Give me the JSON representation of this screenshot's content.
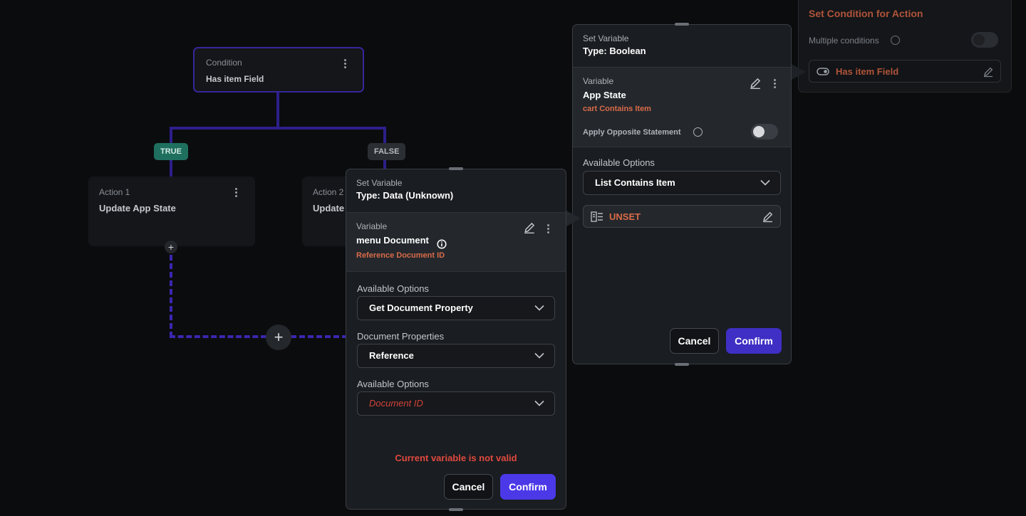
{
  "canvas": {
    "condition_node": {
      "label": "Condition",
      "title": "Has item Field"
    },
    "true_pill": "TRUE",
    "false_pill": "FALSE",
    "action1": {
      "label": "Action 1",
      "title": "Update App State"
    },
    "action2": {
      "label": "Action 2",
      "title": "Update"
    },
    "add_symbol": "+"
  },
  "set_condition_panel": {
    "title": "Set Condition for Action",
    "multiple_conditions_label": "Multiple conditions",
    "condition_chip": "Has item Field"
  },
  "boolean_panel": {
    "header_small": "Set Variable",
    "header_type": "Type: Boolean",
    "variable_label": "Variable",
    "variable_name": "App State",
    "variable_ref": "cart Contains Item",
    "opposite_label": "Apply Opposite Statement",
    "available_options_label": "Available Options",
    "available_options_value": "List Contains Item",
    "unset_value": "UNSET",
    "cancel": "Cancel",
    "confirm": "Confirm"
  },
  "data_panel": {
    "header_small": "Set Variable",
    "header_type": "Type: Data (Unknown)",
    "variable_label": "Variable",
    "variable_name": "menu Document",
    "variable_ref": "Reference Document ID",
    "options_label_1": "Available Options",
    "options_value_1": "Get Document Property",
    "doc_props_label": "Document Properties",
    "doc_props_value": "Reference",
    "options_label_2": "Available Options",
    "options_value_2": "Document ID",
    "error": "Current variable is not valid",
    "cancel": "Cancel",
    "confirm": "Confirm"
  },
  "colors": {
    "accent": "#4b39e8",
    "error": "#e0493f",
    "reference": "#d96a48",
    "true_pill": "#1f6f5f",
    "flow_line": "#2c1f8a"
  }
}
